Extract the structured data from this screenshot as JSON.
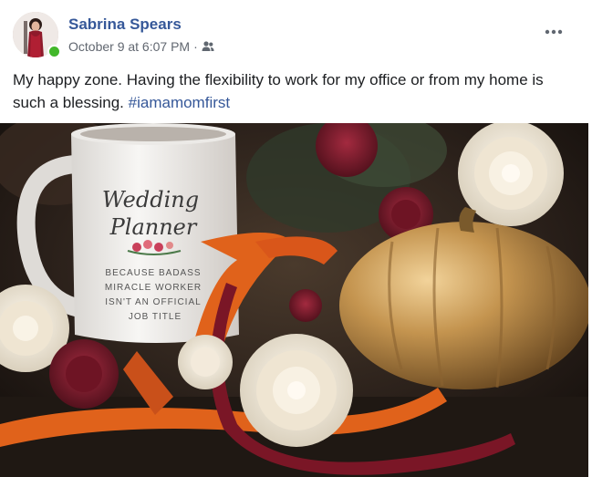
{
  "post": {
    "author": "Sabrina Spears",
    "timestamp": "October 9 at 6:07 PM",
    "separator": "·",
    "audience_icon": "friends-icon",
    "more_icon": "more-options-icon",
    "text": "My happy zone. Having the flexibility to work for my office or from my home is such a blessing.",
    "hashtag": "#iamamomfirst"
  },
  "photo": {
    "mug_title_line1": "Wedding",
    "mug_title_line2": "Planner",
    "mug_subtext_line1": "BECAUSE BADASS",
    "mug_subtext_line2": "MIRACLE WORKER",
    "mug_subtext_line3": "ISN'T AN OFFICIAL",
    "mug_subtext_line4": "JOB TITLE"
  },
  "colors": {
    "name_blue": "#365899",
    "online_green": "#42b72a",
    "meta_gray": "#616770",
    "ribbon_orange": "#e0621b",
    "ribbon_burgundy": "#7a1626",
    "pumpkin_gold": "#b8894a"
  }
}
